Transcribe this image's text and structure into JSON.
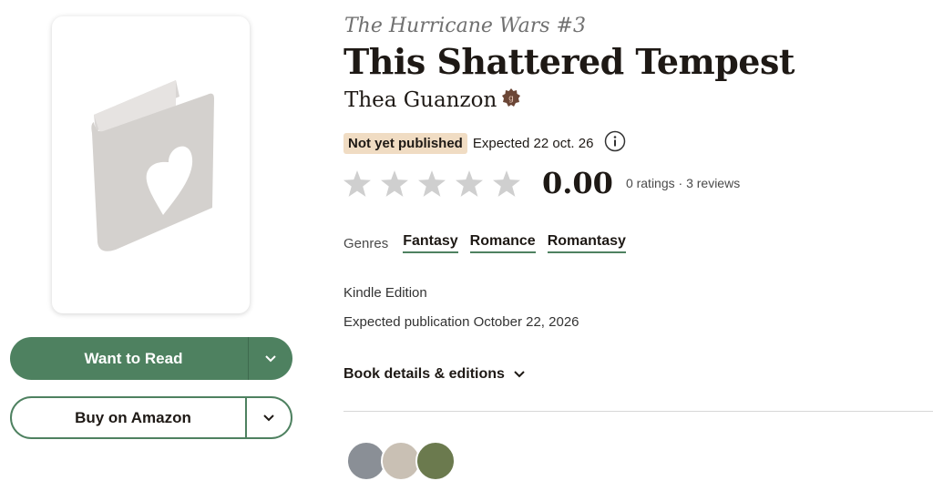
{
  "cover": {
    "icon": "book-heart-icon"
  },
  "actions": {
    "want_to_read": "Want to Read",
    "buy": "Buy on Amazon"
  },
  "book": {
    "series": "The Hurricane Wars #3",
    "title": "This Shattered Tempest",
    "author": "Thea Guanzon",
    "status_badge": "Not yet published",
    "expected_short": "Expected 22 oct. 26",
    "rating_value": "0.00",
    "rating_meta": "0 ratings · 3 reviews",
    "stars": [
      0,
      0,
      0,
      0,
      0
    ],
    "genres_label": "Genres",
    "genres": [
      "Fantasy",
      "Romance",
      "Romantasy"
    ],
    "edition": "Kindle Edition",
    "expected_publication": "Expected publication October 22, 2026",
    "details_link": "Book details & editions"
  },
  "colors": {
    "accent": "#4e8160",
    "badge_bg": "#f0dcc3",
    "star": "#cfcfcf"
  }
}
